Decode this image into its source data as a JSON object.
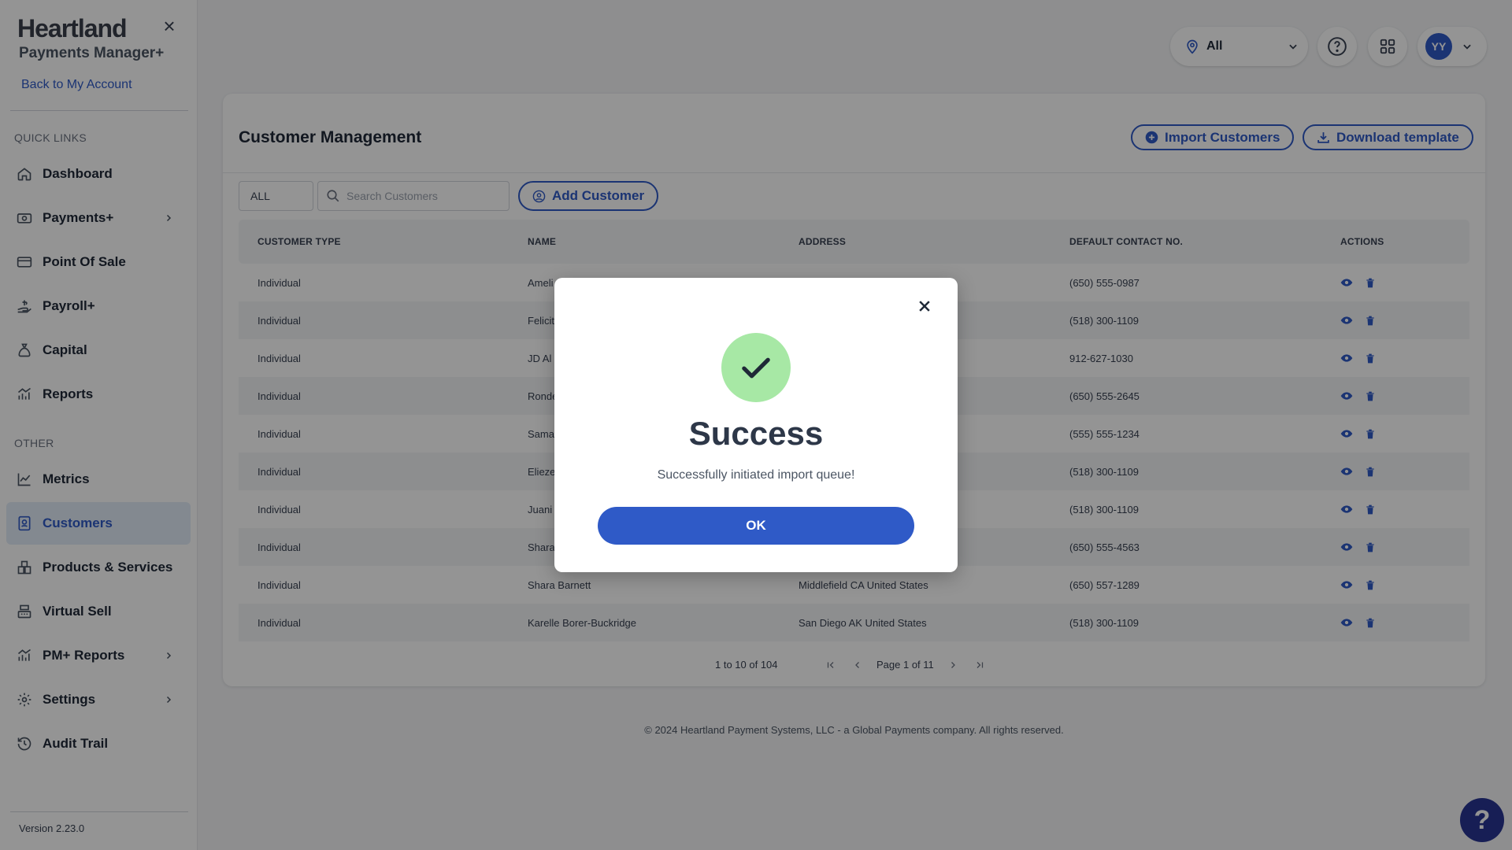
{
  "brand": {
    "name": "Heartland",
    "subtitle": "Payments Manager+"
  },
  "sidebar": {
    "back_link": "Back to My Account",
    "quick_links_label": "QUICK LINKS",
    "other_label": "OTHER",
    "items": [
      {
        "label": "Dashboard",
        "icon": "home-icon"
      },
      {
        "label": "Payments+",
        "icon": "payments-icon"
      },
      {
        "label": "Point Of Sale",
        "icon": "card-icon"
      },
      {
        "label": "Payroll+",
        "icon": "payroll-icon"
      },
      {
        "label": "Capital",
        "icon": "money-bag-icon"
      },
      {
        "label": "Reports",
        "icon": "reports-icon"
      },
      {
        "label": "Metrics",
        "icon": "line-chart-icon"
      },
      {
        "label": "Customers",
        "icon": "customers-icon"
      },
      {
        "label": "Products & Services",
        "icon": "products-icon"
      },
      {
        "label": "Virtual Sell",
        "icon": "register-icon"
      },
      {
        "label": "PM+ Reports",
        "icon": "reports-icon"
      },
      {
        "label": "Settings",
        "icon": "gear-icon"
      },
      {
        "label": "Audit Trail",
        "icon": "history-icon"
      }
    ],
    "version": "Version 2.23.0"
  },
  "topbar": {
    "location": "All",
    "avatar_initials": "YY"
  },
  "main": {
    "title": "Customer Management",
    "import_label": "Import Customers",
    "download_label": "Download template",
    "filter_value": "ALL",
    "search_placeholder": "Search Customers",
    "add_label": "Add Customer",
    "columns": [
      "CUSTOMER TYPE",
      "NAME",
      "ADDRESS",
      "DEFAULT CONTACT NO.",
      "ACTIONS"
    ],
    "rows": [
      {
        "type": "Individual",
        "name": "Ameli",
        "address": "",
        "phone": "(650) 555-0987"
      },
      {
        "type": "Individual",
        "name": "Felicit",
        "address": "",
        "phone": "(518) 300-1109"
      },
      {
        "type": "Individual",
        "name": "JD Al",
        "address": "",
        "phone": "912-627-1030"
      },
      {
        "type": "Individual",
        "name": "Ronde",
        "address": "",
        "phone": "(650) 555-2645"
      },
      {
        "type": "Individual",
        "name": "Sama",
        "address": "",
        "phone": "(555) 555-1234"
      },
      {
        "type": "Individual",
        "name": "Elieze",
        "address": "",
        "phone": "(518) 300-1109"
      },
      {
        "type": "Individual",
        "name": "Juani",
        "address": "",
        "phone": "(518) 300-1109"
      },
      {
        "type": "Individual",
        "name": "Shara",
        "address": "",
        "phone": "(650) 555-4563"
      },
      {
        "type": "Individual",
        "name": "Shara Barnett",
        "address": "Middlefield CA United States",
        "phone": "(650) 557-1289"
      },
      {
        "type": "Individual",
        "name": "Karelle Borer-Buckridge",
        "address": "San Diego AK United States",
        "phone": "(518) 300-1109"
      }
    ],
    "pager": {
      "range": "1 to 10 of 104",
      "page": "Page 1 of 11"
    }
  },
  "footer": "© 2024 Heartland Payment Systems, LLC - a Global Payments company. All rights reserved.",
  "modal": {
    "title": "Success",
    "message": "Successfully initiated import queue!",
    "ok_label": "OK"
  },
  "help_fab": "?",
  "colors": {
    "accent": "#2f5ac7",
    "success": "#a7e8a5",
    "fab": "#283593"
  }
}
